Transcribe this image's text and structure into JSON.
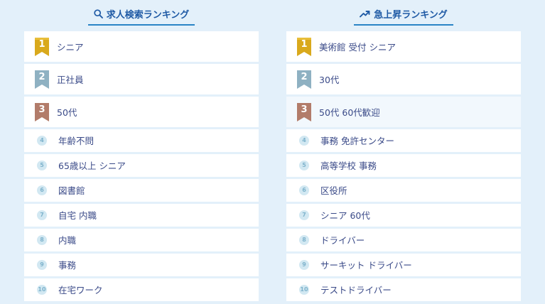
{
  "left": {
    "title": "求人検索ランキング",
    "icon": "search-icon",
    "items": [
      {
        "rank": "1",
        "label": "シニア"
      },
      {
        "rank": "2",
        "label": "正社員"
      },
      {
        "rank": "3",
        "label": "50代"
      },
      {
        "rank": "4",
        "label": "年齢不問"
      },
      {
        "rank": "5",
        "label": "65歳以上 シニア"
      },
      {
        "rank": "6",
        "label": "図書館"
      },
      {
        "rank": "7",
        "label": "自宅 内職"
      },
      {
        "rank": "8",
        "label": "内職"
      },
      {
        "rank": "9",
        "label": "事務"
      },
      {
        "rank": "10",
        "label": "在宅ワーク"
      }
    ]
  },
  "right": {
    "title": "急上昇ランキング",
    "icon": "trending-up-icon",
    "items": [
      {
        "rank": "1",
        "label": "美術館 受付 シニア"
      },
      {
        "rank": "2",
        "label": "30代"
      },
      {
        "rank": "3",
        "label": "50代 60代歓迎"
      },
      {
        "rank": "4",
        "label": "事務 免許センター"
      },
      {
        "rank": "5",
        "label": "高等学校 事務"
      },
      {
        "rank": "6",
        "label": "区役所"
      },
      {
        "rank": "7",
        "label": "シニア 60代"
      },
      {
        "rank": "8",
        "label": "ドライバー"
      },
      {
        "rank": "9",
        "label": "サーキット ドライバー"
      },
      {
        "rank": "10",
        "label": "テストドライバー"
      }
    ]
  },
  "colors": {
    "gold": "#d9a91c",
    "silver": "#8fb1c2",
    "bronze": "#b27c6a",
    "accent": "#2a84c6",
    "heading_text": "#1f5aa5",
    "item_text": "#3a4a88",
    "background": "#e3f0fa"
  }
}
